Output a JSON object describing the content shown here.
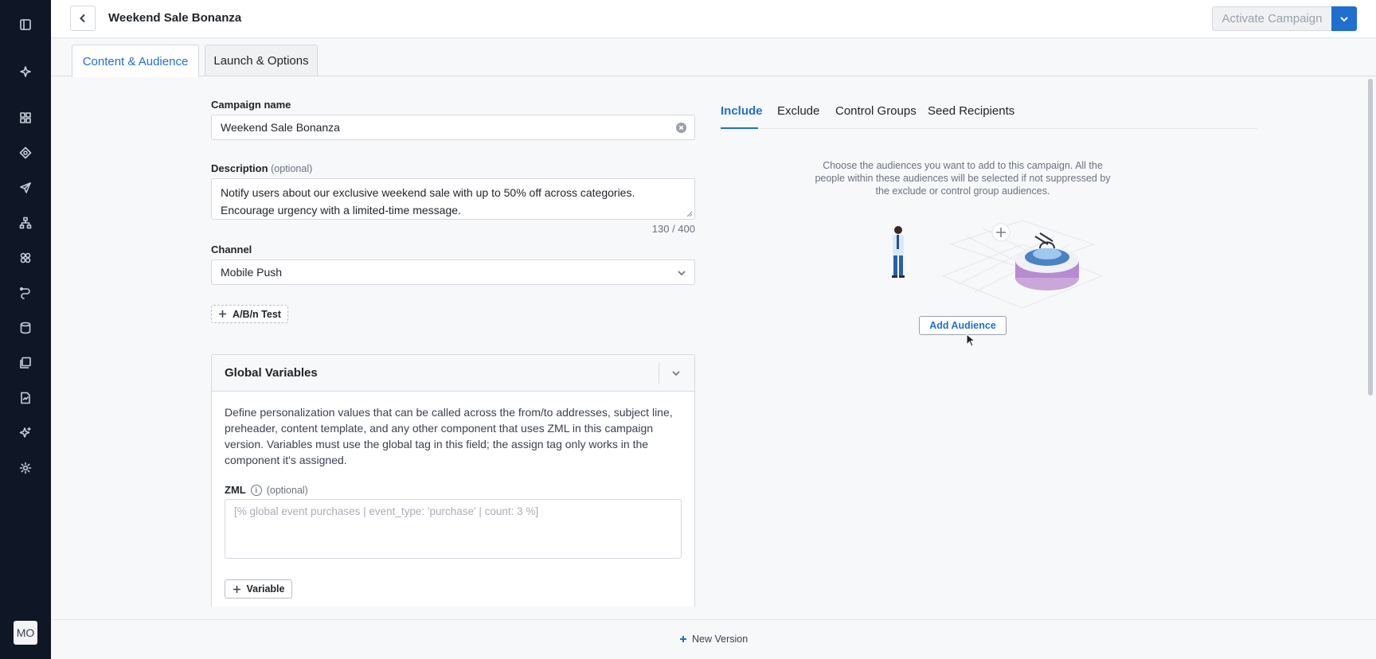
{
  "header": {
    "title": "Weekend Sale Bonanza",
    "activate_label": "Activate Campaign"
  },
  "tabs": [
    {
      "label": "Content & Audience",
      "active": true
    },
    {
      "label": "Launch & Options",
      "active": false
    }
  ],
  "form": {
    "campaign_name_label": "Campaign name",
    "campaign_name_value": "Weekend Sale Bonanza",
    "description_label": "Description",
    "optional_text": "(optional)",
    "description_value": "Notify users about our exclusive weekend sale with up to 50% off across categories. Encourage urgency with a limited-time message.",
    "description_counter": "130 / 400",
    "channel_label": "Channel",
    "channel_value": "Mobile Push",
    "ab_test_label": "A/B/n Test"
  },
  "global_variables": {
    "title": "Global Variables",
    "description": "Define personalization values that can be called across the from/to addresses, subject line, preheader, content template, and any other component that uses ZML in this campaign version. Variables must use the global tag in this field; the assign tag only works in the component it's assigned.",
    "zml_label": "ZML",
    "zml_placeholder": "[% global event purchases | event_type: 'purchase' | count: 3 %]",
    "variable_button": "Variable"
  },
  "audience": {
    "tabs": [
      {
        "label": "Include",
        "active": true
      },
      {
        "label": "Exclude",
        "active": false
      },
      {
        "label": "Control Groups",
        "active": false
      },
      {
        "label": "Seed Recipients",
        "active": false
      }
    ],
    "help_text": "Choose the audiences you want to add to this campaign. All the people within these audiences will be selected if not suppressed by the exclude or control group audiences.",
    "add_button": "Add Audience"
  },
  "sidebar": {
    "icons": [
      "panel-toggle-icon",
      "sparkle-icon",
      "dashboard-icon",
      "target-icon",
      "send-icon",
      "hierarchy-icon",
      "people-icon",
      "journey-icon",
      "database-icon",
      "library-icon",
      "report-icon",
      "ai-icon",
      "settings-icon"
    ],
    "avatar_initials": "MO"
  },
  "footer": {
    "new_version_label": "New Version"
  },
  "colors": {
    "accent": "#1f6fd1",
    "sidebar_bg": "#0f1626"
  }
}
